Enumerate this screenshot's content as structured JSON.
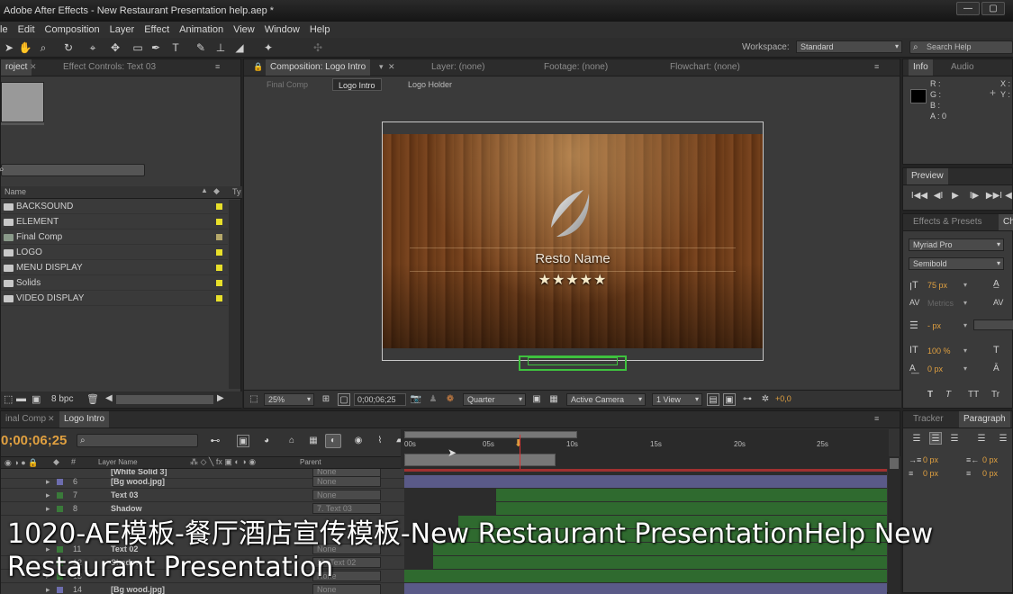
{
  "window": {
    "title": "Adobe After Effects - New Restaurant Presentation help.aep *",
    "controls": [
      "—",
      "▢",
      "✕"
    ]
  },
  "menu": [
    "le",
    "Edit",
    "Composition",
    "Layer",
    "Effect",
    "Animation",
    "View",
    "Window",
    "Help"
  ],
  "toolbar": {
    "workspace_label": "Workspace:",
    "workspace_value": "Standard",
    "search_placeholder": "Search Help"
  },
  "project_panel": {
    "tab_project": "roject",
    "tab_effect_controls": "Effect Controls: Text 03",
    "search_value": "",
    "col_name": "Name",
    "col_type": "Ty",
    "items": [
      {
        "name": "BACKSOUND",
        "kind": "folder",
        "color": "#e8e02a"
      },
      {
        "name": "ELEMENT",
        "kind": "folder",
        "color": "#e8e02a"
      },
      {
        "name": "Final Comp",
        "kind": "comp",
        "color": "#b5a86a"
      },
      {
        "name": "LOGO",
        "kind": "folder",
        "color": "#e8e02a"
      },
      {
        "name": "MENU DISPLAY",
        "kind": "folder",
        "color": "#e8e02a"
      },
      {
        "name": "Solids",
        "kind": "folder",
        "color": "#e8e02a"
      },
      {
        "name": "VIDEO DISPLAY",
        "kind": "folder",
        "color": "#e8e02a"
      }
    ],
    "bpc": "8 bpc"
  },
  "composition_panel": {
    "tab_comp": "Composition: Logo Intro",
    "tab_layer": "Layer: (none)",
    "tab_footage": "Footage: (none)",
    "tab_flowchart": "Flowchart: (none)",
    "breadcrumbs": [
      "Final Comp",
      "Logo Intro",
      "Logo Holder"
    ],
    "resto_name": "Resto Name",
    "stars": "★★★★★",
    "zoom": "25%",
    "timecode": "0;00;06;25",
    "resolution": "Quarter",
    "camera": "Active Camera",
    "views": "1 View",
    "exposure": "+0,0"
  },
  "info_panel": {
    "tab_info": "Info",
    "tab_audio": "Audio",
    "r": "R :",
    "g": "G :",
    "b": "B :",
    "a": "A :  0",
    "x": "X :",
    "y": "Y :"
  },
  "preview_panel": {
    "tab": "Preview",
    "buttons": [
      "I◀◀",
      "◀I",
      "▶",
      "I▶",
      "▶▶I",
      "◀"
    ]
  },
  "character_panel": {
    "tab_effects": "Effects & Presets",
    "tab_ch": "Ch",
    "font": "Myriad Pro",
    "style": "Semibold",
    "size": "75 px",
    "kerning": "Metrics",
    "leading": "- px",
    "vscale": "100 %",
    "baseline": "0 px",
    "styles": [
      "T",
      "T",
      "TT",
      "Tr"
    ]
  },
  "paragraph_panel": {
    "tab_tracker": "Tracker",
    "tab_paragraph": "Paragraph",
    "indent_left": "0 px",
    "indent_right": "0 px",
    "space_before": "0 px",
    "space_after": "0 px"
  },
  "timeline": {
    "tab_final": "inal Comp",
    "tab_logo": "Logo Intro",
    "timecode": "0;00;06;25",
    "search_value": "",
    "col_layer_name": "Layer Name",
    "col_parent": "Parent",
    "ruler": [
      "00s",
      "05s",
      "10s",
      "15s",
      "20s",
      "25s"
    ],
    "layers": [
      {
        "num": "",
        "name": "[White Solid 3]",
        "parent": "None",
        "color": "#6d6dae"
      },
      {
        "num": "6",
        "name": "[Bg wood.jpg]",
        "parent": "None",
        "color": "#6d6dae"
      },
      {
        "num": "7",
        "name": "Text 03",
        "parent": "None",
        "color": "#3a7a3a"
      },
      {
        "num": "8",
        "name": "Shadow",
        "parent": "7. Text 03",
        "color": "#3a7a3a"
      },
      {
        "num": "9",
        "name": "",
        "parent": "",
        "color": "#3a7a3a"
      },
      {
        "num": "10",
        "name": "",
        "parent": "",
        "color": "#3a7a3a"
      },
      {
        "num": "11",
        "name": "Text 02",
        "parent": "None",
        "color": "#3a7a3a"
      },
      {
        "num": "12",
        "name": "Shadow",
        "parent": "11. Text 02",
        "color": "#3a7a3a"
      },
      {
        "num": "13",
        "name": "",
        "parent": "None",
        "color": "#3a7a3a"
      },
      {
        "num": "14",
        "name": "[Bg wood.jpg]",
        "parent": "None",
        "color": "#6d6dae"
      }
    ]
  },
  "caption": {
    "line1": "1020-AE模板-餐厅酒店宣传模板-New Restaurant PresentationHelp New",
    "line2": "Restaurant Presentation"
  }
}
